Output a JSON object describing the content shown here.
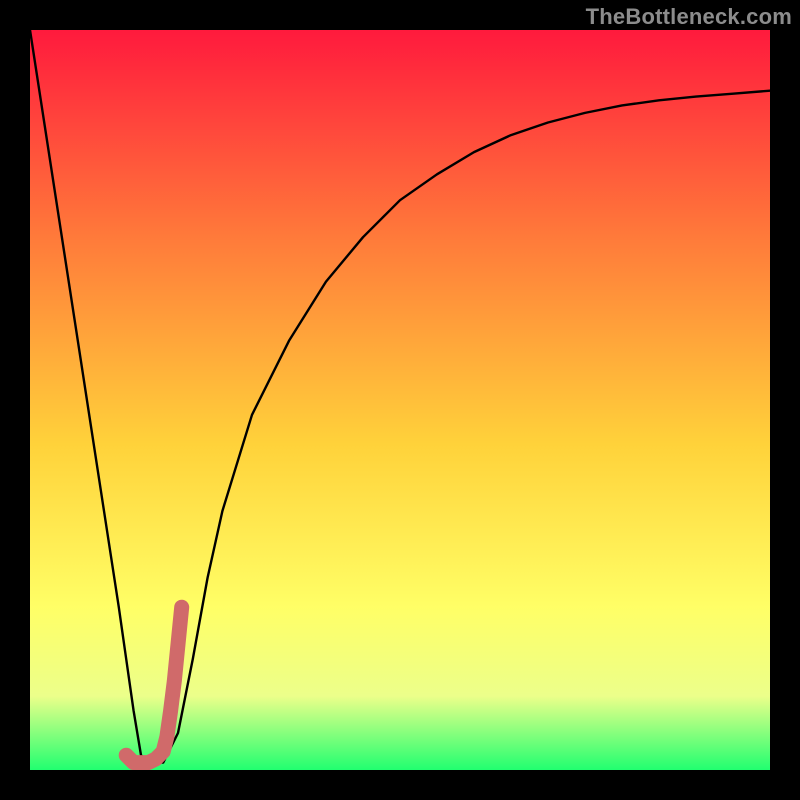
{
  "watermark": "TheBottleneck.com",
  "colors": {
    "frame": "#000000",
    "gradient_top": "#ff1a3d",
    "gradient_mid1": "#ff7a3a",
    "gradient_mid2": "#ffd23a",
    "gradient_mid3": "#ffff66",
    "gradient_mid4": "#ecff8a",
    "gradient_bottom": "#21ff70",
    "curve": "#000000",
    "accent": "#d06a6a"
  },
  "chart_data": {
    "type": "line",
    "title": "",
    "xlabel": "",
    "ylabel": "",
    "xlim": [
      0,
      100
    ],
    "ylim": [
      0,
      100
    ],
    "series": [
      {
        "name": "bottleneck-curve",
        "x": [
          0,
          2,
          4,
          6,
          8,
          10,
          12,
          13,
          14,
          15,
          16,
          18,
          20,
          22,
          24,
          26,
          30,
          35,
          40,
          45,
          50,
          55,
          60,
          65,
          70,
          75,
          80,
          85,
          90,
          95,
          100
        ],
        "y": [
          100,
          87,
          74,
          61,
          48,
          35,
          22,
          15,
          8,
          2,
          1,
          1,
          5,
          15,
          26,
          35,
          48,
          58,
          66,
          72,
          77,
          80.5,
          83.5,
          85.8,
          87.5,
          88.8,
          89.8,
          90.5,
          91,
          91.4,
          91.8
        ]
      },
      {
        "name": "accent-segment",
        "x": [
          13,
          14,
          15,
          16,
          17,
          18,
          18.5,
          19,
          19.5,
          20,
          20.5
        ],
        "y": [
          2,
          1,
          1,
          1,
          1.5,
          2.5,
          4.5,
          8,
          12,
          17,
          22
        ]
      }
    ],
    "gradient_stops": [
      {
        "offset": 0.0,
        "color": "#ff1a3d"
      },
      {
        "offset": 0.28,
        "color": "#ff7a3a"
      },
      {
        "offset": 0.56,
        "color": "#ffd23a"
      },
      {
        "offset": 0.78,
        "color": "#ffff66"
      },
      {
        "offset": 0.9,
        "color": "#ecff8a"
      },
      {
        "offset": 1.0,
        "color": "#21ff70"
      }
    ]
  }
}
